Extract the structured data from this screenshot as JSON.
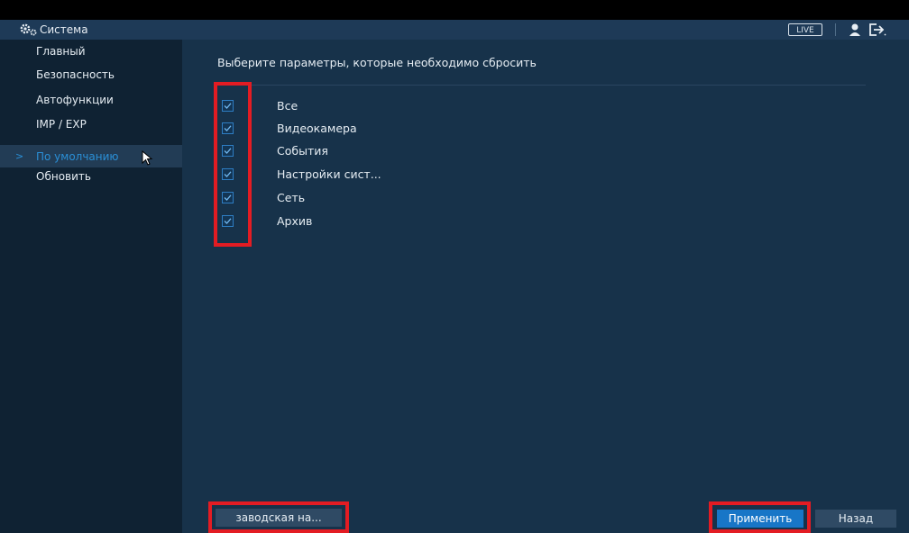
{
  "topbar": {
    "title": "Система",
    "live_label": "LIVE"
  },
  "sidebar": {
    "items": [
      {
        "label": "Главный"
      },
      {
        "label": "Безопасность"
      },
      {
        "label": "Автофункции"
      },
      {
        "label": "IMP / EXP"
      },
      {
        "label": "По умолчанию",
        "active": true
      },
      {
        "label": "Обновить"
      }
    ]
  },
  "main": {
    "heading": "Выберите параметры, которые необходимо сбросить",
    "options": [
      {
        "label": "Все",
        "checked": true
      },
      {
        "label": "Видеокамера",
        "checked": true
      },
      {
        "label": "События",
        "checked": true
      },
      {
        "label": "Настройки сист...",
        "checked": true
      },
      {
        "label": "Сеть",
        "checked": true
      },
      {
        "label": "Архив",
        "checked": true
      }
    ]
  },
  "footer": {
    "factory_label": "заводская на...",
    "apply_label": "Применить",
    "back_label": "Назад"
  },
  "colors": {
    "accent": "#1876c7",
    "highlight": "#e31c23",
    "active_text": "#2a8fd6"
  }
}
